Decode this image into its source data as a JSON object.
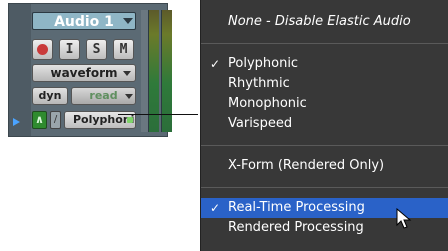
{
  "track": {
    "name": "Audio 1",
    "buttons": {
      "record": "",
      "input": "I",
      "solo": "S",
      "mute": "M"
    },
    "view": "waveform",
    "dyn": "dyn",
    "automation": "read",
    "elastic_audio": "Polyphonic",
    "meter_colors": {
      "top": "#5c5a2a",
      "bottom": "#2b6e3a"
    }
  },
  "menu": {
    "items": [
      {
        "label": "None - Disable Elastic Audio",
        "italic": true
      },
      {
        "label": "Polyphonic",
        "checked": true
      },
      {
        "label": "Rhythmic"
      },
      {
        "label": "Monophonic"
      },
      {
        "label": "Varispeed"
      },
      {
        "label": "X-Form (Rendered Only)"
      },
      {
        "label": "Real-Time Processing",
        "checked": true,
        "highlighted": true
      },
      {
        "label": "Rendered Processing"
      }
    ],
    "check_mark": "✓"
  },
  "colors": {
    "menu_bg": "#303030",
    "highlight": "#2a62c8"
  }
}
